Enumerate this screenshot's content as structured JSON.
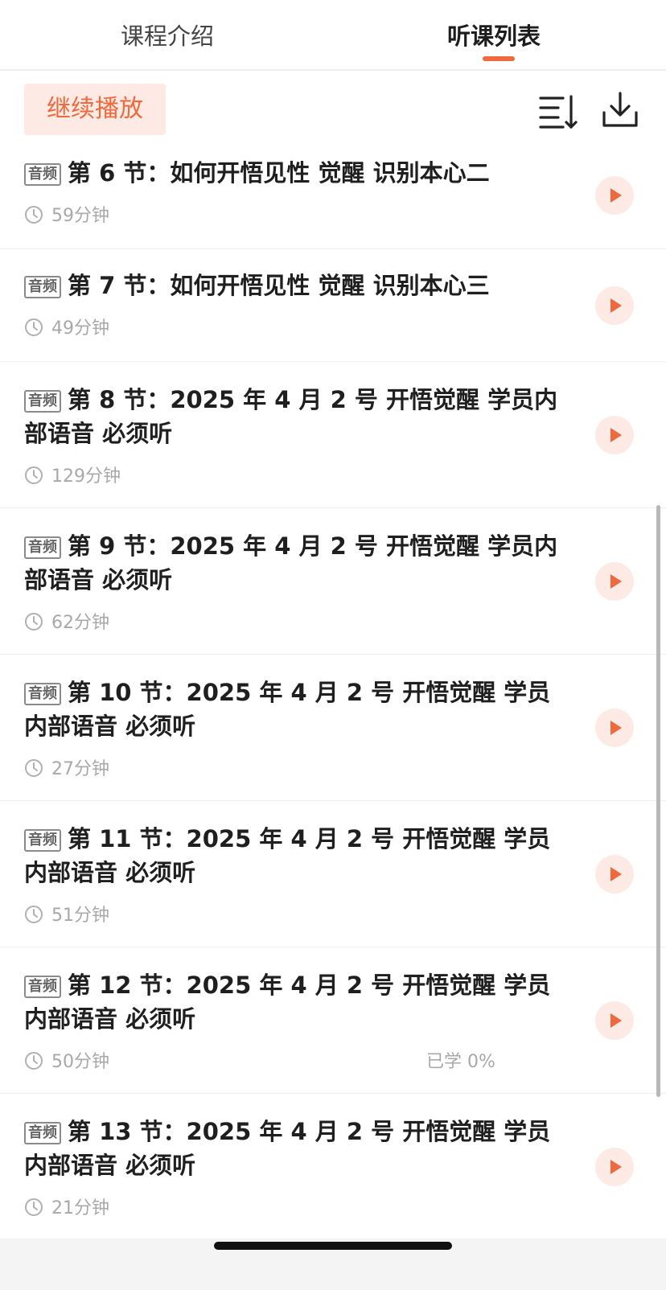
{
  "tabs": {
    "intro": "课程介绍",
    "list": "听课列表"
  },
  "toolbar": {
    "continue_label": "继续播放",
    "sort_icon": "sort-list-icon",
    "download_icon": "download-icon"
  },
  "colors": {
    "accent": "#ee6a3e",
    "accent_bg": "#fdeae4",
    "muted_text": "#a8a8a8"
  },
  "badge_label": "音频",
  "lessons": [
    {
      "title": "第 6 节：如何开悟见性 觉醒 识别本心二",
      "duration": "59分钟",
      "progress": ""
    },
    {
      "title": "第 7 节：如何开悟见性 觉醒 识别本心三",
      "duration": "49分钟",
      "progress": ""
    },
    {
      "title": "第 8 节：2025 年 4 月 2 号 开悟觉醒 学员内部语音 必须听",
      "duration": "129分钟",
      "progress": ""
    },
    {
      "title": "第 9 节：2025 年 4 月 2 号 开悟觉醒 学员内部语音 必须听",
      "duration": "62分钟",
      "progress": ""
    },
    {
      "title": "第 10 节：2025 年 4 月 2 号 开悟觉醒 学员内部语音 必须听",
      "duration": "27分钟",
      "progress": ""
    },
    {
      "title": "第 11 节：2025 年 4 月 2 号 开悟觉醒 学员内部语音 必须听",
      "duration": "51分钟",
      "progress": ""
    },
    {
      "title": "第 12 节：2025 年 4 月 2 号 开悟觉醒 学员内部语音 必须听",
      "duration": "50分钟",
      "progress": "已学 0%"
    },
    {
      "title": "第 13 节：2025 年 4 月 2 号 开悟觉醒 学员内部语音 必须听",
      "duration": "21分钟",
      "progress": ""
    }
  ]
}
